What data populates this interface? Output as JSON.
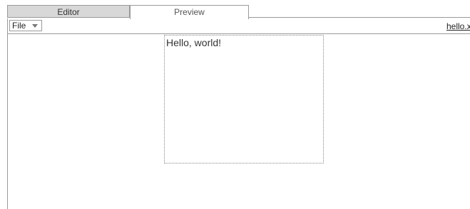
{
  "tabs": [
    {
      "label": "Editor",
      "active": false
    },
    {
      "label": "Preview",
      "active": true
    }
  ],
  "toolbar": {
    "file_menu": {
      "label": "File",
      "icon": "chevron-down-icon"
    },
    "file_name": "hello.xml"
  },
  "preview": {
    "content": "Hello, world!"
  }
}
